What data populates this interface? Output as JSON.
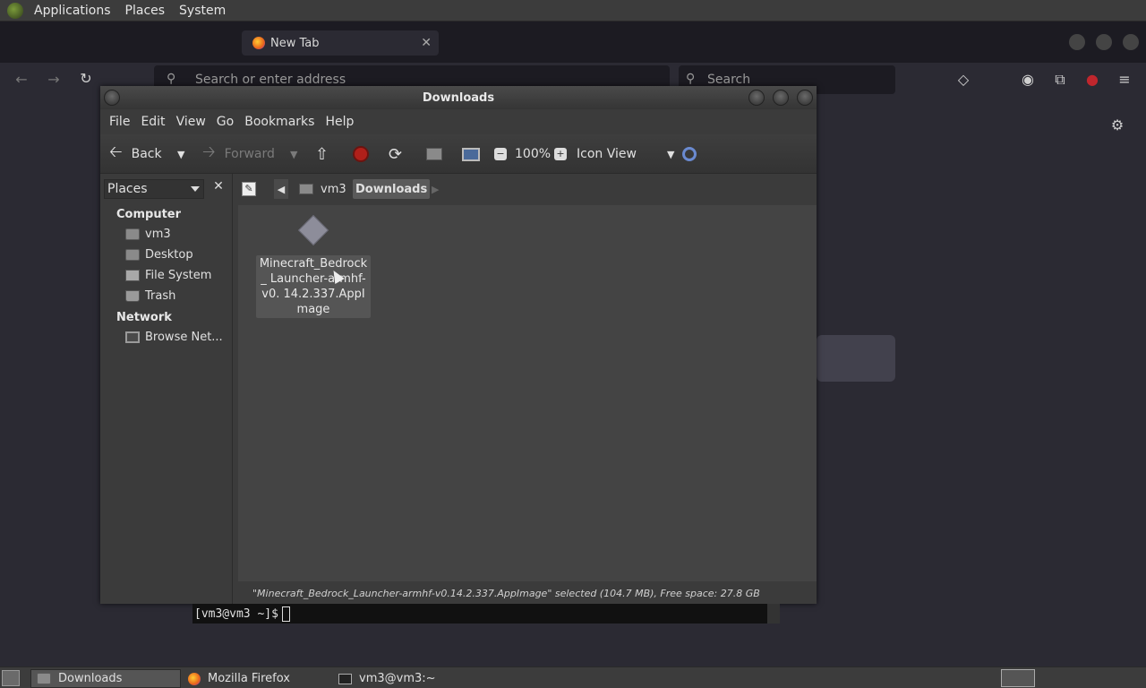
{
  "top_panel": {
    "menus": [
      "Applications",
      "Places",
      "System"
    ]
  },
  "firefox": {
    "active_tab": "New Tab",
    "urlbar_placeholder": "Search or enter address",
    "search_placeholder": "Search"
  },
  "file_manager": {
    "title": "Downloads",
    "menu": [
      "File",
      "Edit",
      "View",
      "Go",
      "Bookmarks",
      "Help"
    ],
    "toolbar": {
      "back": "Back",
      "forward": "Forward",
      "zoom": "100%",
      "view_mode": "Icon View"
    },
    "sidebar": {
      "places_label": "Places",
      "computer_heading": "Computer",
      "computer_items": [
        "vm3",
        "Desktop",
        "File System",
        "Trash"
      ],
      "network_heading": "Network",
      "network_items": [
        "Browse Net..."
      ]
    },
    "pathbar": {
      "parent": "vm3",
      "current": "Downloads"
    },
    "files": [
      {
        "name": "Minecraft_Bedrock_Launcher-armhf-v0.14.2.337.AppImage",
        "display": "Minecraft_Bedrock_ Launcher-armhf-v0. 14.2.337.AppImage",
        "selected": true
      }
    ],
    "status": "\"Minecraft_Bedrock_Launcher-armhf-v0.14.2.337.AppImage\" selected (104.7 MB), Free space: 27.8 GB"
  },
  "terminal": {
    "prompt": "[vm3@vm3 ~]$"
  },
  "taskbar": {
    "tasks": [
      "Downloads",
      "Mozilla Firefox",
      "vm3@vm3:~"
    ]
  }
}
